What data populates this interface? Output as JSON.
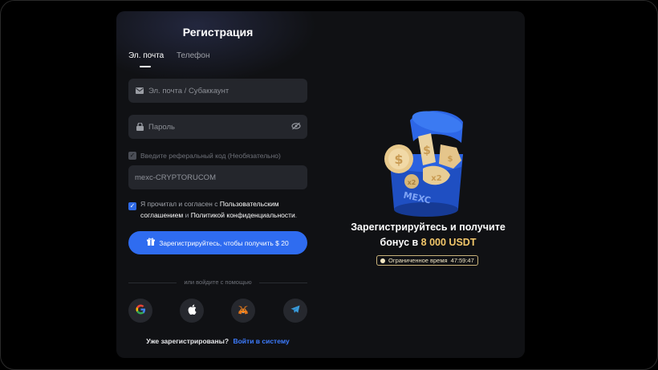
{
  "register": {
    "title": "Регистрация",
    "tabs": [
      {
        "label": "Эл. почта",
        "active": true
      },
      {
        "label": "Телефон",
        "active": false
      }
    ],
    "email_placeholder": "Эл. почта / Субаккаунт",
    "password_placeholder": "Пароль",
    "referral_label": "Введите реферальный код (Необязательно)",
    "referral_value": "mexc-CRYPTORUCOM",
    "agree_prefix": "Я прочитал и согласен с",
    "agree_link1": "Пользовательским соглашением",
    "agree_and": "и",
    "agree_link2": "Политикой конфиденциальности",
    "agree_suffix": ".",
    "submit_label": "Зарегистрируйтесь, чтобы получить $ 20",
    "social_divider": "или войдите с помощью",
    "socials": [
      "google-icon",
      "apple-icon",
      "metamask-icon",
      "telegram-icon"
    ],
    "have_account": "Уже зарегистрированы?",
    "login_link": "Войти в систему"
  },
  "promo": {
    "line1": "Зарегистрируйтесь и получите",
    "line2_prefix": "бонус в",
    "line2_amount": "8 000 USDT",
    "timer_label": "Ограниченное время",
    "timer_value": "47:59:47",
    "logo_text": "MEXC"
  },
  "colors": {
    "accent": "#2f6cf0",
    "gold": "#f3c76a",
    "panel": "#101114"
  }
}
